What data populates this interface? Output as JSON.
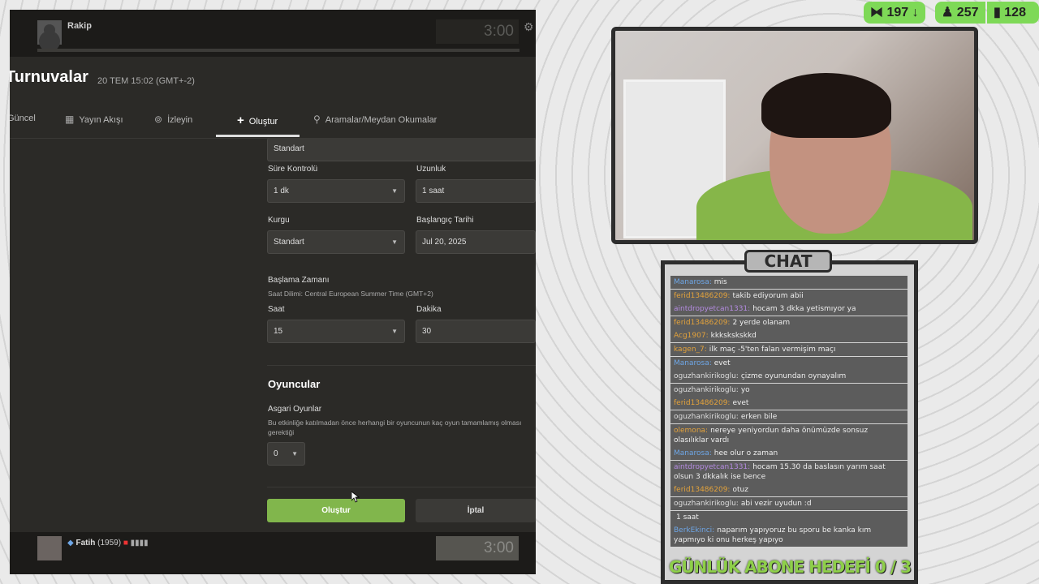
{
  "game": {
    "opponent": {
      "name": "Rakip",
      "clock": "3:00"
    },
    "title": "Turnuvalar",
    "date": "20 TEM  15:02  (GMT+-2)",
    "tabs": [
      {
        "label": "Güncel",
        "icon": "none"
      },
      {
        "label": "Yayın Akışı",
        "icon": "calendar-icon"
      },
      {
        "label": "İzleyin",
        "icon": "binoculars-icon"
      },
      {
        "label": "Oluştur",
        "icon": "plus-icon",
        "active": true
      },
      {
        "label": "Aramalar/Meydan Okumalar",
        "icon": "search-icon"
      }
    ],
    "form": {
      "variant_value": "Standart",
      "time_control_label": "Süre Kontrolü",
      "time_control_value": "1 dk",
      "duration_label": "Uzunluk",
      "duration_value": "1 saat",
      "setup_label": "Kurgu",
      "setup_value": "Standart",
      "start_date_label": "Başlangıç Tarihi",
      "start_date_value": "Jul 20, 2025",
      "start_time_label": "Başlama Zamanı",
      "timezone_hint": "Saat Dilimi: Central European Summer Time (GMT+2)",
      "hour_label": "Saat",
      "hour_value": "15",
      "minute_label": "Dakika",
      "minute_value": "30",
      "players_title": "Oyuncular",
      "min_games_label": "Asgari Oyunlar",
      "min_games_hint": "Bu etkinliğe katılmadan önce herhangi bir oyuncunun kaç oyun tamamlamış olması gerektiği",
      "min_games_value": "0",
      "create_label": "Oluştur",
      "cancel_label": "İptal"
    },
    "player": {
      "name": "Fatih",
      "rating": "(1959)",
      "clock": "3:00"
    }
  },
  "stats": [
    {
      "icon": "k-icon",
      "value": "197",
      "arrow": "down"
    },
    {
      "icon": "user-icon",
      "value": "257"
    },
    {
      "icon": "bar-chart-icon",
      "value": "128"
    }
  ],
  "chat": {
    "header": "CHAT",
    "messages": [
      {
        "user": "Manarosa:",
        "text": "mis",
        "color": "#6ea6e6"
      },
      {
        "user": "ferid13486209:",
        "text": "takib ediyorum abii",
        "color": "#e3a23b"
      },
      {
        "user": "aintdropyetcan1331:",
        "text": "hocam 3 dkka yetismıyor ya",
        "color": "#b48be0"
      },
      {
        "user": "ferid13486209:",
        "text": "2 yerde olanam",
        "color": "#e3a23b"
      },
      {
        "user": "Acg1907:",
        "text": "kkkskskskkd",
        "color": "#e3a23b"
      },
      {
        "user": "kagen_7:",
        "text": "ilk maç -5'ten falan vermişim maçı",
        "color": "#e3a23b"
      },
      {
        "user": "Manarosa:",
        "text": "evet",
        "color": "#6ea6e6"
      },
      {
        "user": "oguzhankirikoglu:",
        "text": "çizme oyunundan oynayalım",
        "color": "#dddddd"
      },
      {
        "user": "oguzhankirikoglu:",
        "text": "yo",
        "color": "#dddddd"
      },
      {
        "user": "ferid13486209:",
        "text": "evet",
        "color": "#e3a23b"
      },
      {
        "user": "oguzhankirikoglu:",
        "text": "erken bile",
        "color": "#dddddd"
      },
      {
        "user": "olemona:",
        "text": "nereye yeniyordun daha önümüzde sonsuz olasılıklar vardı",
        "color": "#e3a23b"
      },
      {
        "user": "Manarosa:",
        "text": "hee olur o zaman",
        "color": "#6ea6e6"
      },
      {
        "user": "aintdropyetcan1331:",
        "text": "hocam 15.30 da baslasın yarım saat olsun 3 dkkalık ise bence",
        "color": "#b48be0"
      },
      {
        "user": "ferid13486209:",
        "text": "otuz",
        "color": "#e3a23b"
      },
      {
        "user": "oguzhankirikoglu:",
        "text": "abi vezir uyudun :d",
        "color": "#dddddd"
      },
      {
        "user": "",
        "text": "1 saat",
        "color": "#6ea6e6"
      },
      {
        "user": "BerkEkinci:",
        "text": "naparım yapıyoruz bu sporu be kanka kım yapmıyo ki onu herkeş yapıyo",
        "color": "#6ea6e6"
      }
    ],
    "goal": "GÜNLÜK ABONE HEDEFİ  0 / 3"
  }
}
